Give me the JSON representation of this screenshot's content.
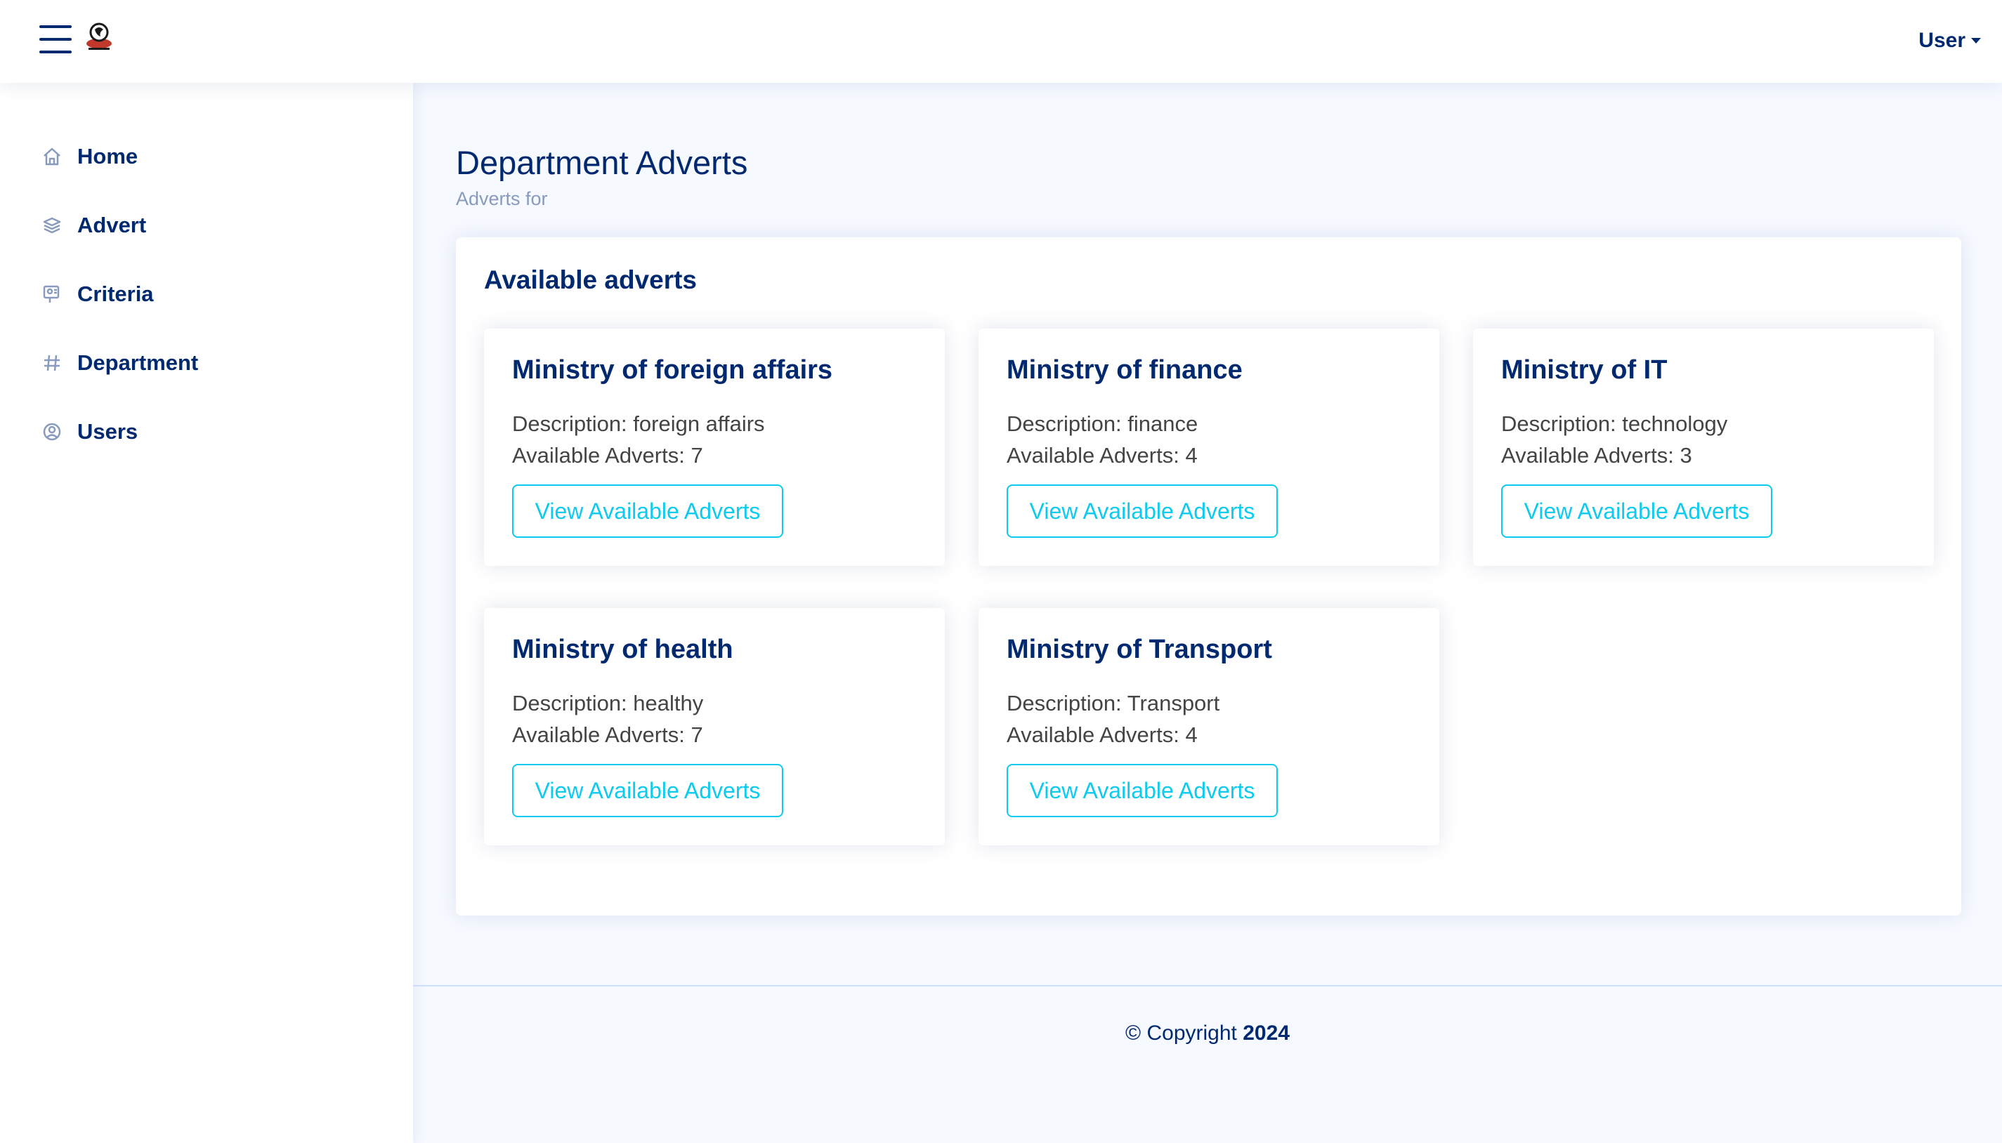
{
  "header": {
    "user_label": "User",
    "icons": {
      "menu": "hamburger-menu-icon",
      "logo": "app-logo",
      "caret": "caret-down-icon"
    }
  },
  "sidebar": {
    "items": [
      {
        "label": "Home",
        "icon": "home-icon"
      },
      {
        "label": "Advert",
        "icon": "layers-icon"
      },
      {
        "label": "Criteria",
        "icon": "person-badge-icon"
      },
      {
        "label": "Department",
        "icon": "hash-icon"
      },
      {
        "label": "Users",
        "icon": "person-circle-icon"
      }
    ]
  },
  "main": {
    "title": "Department Adverts",
    "subtitle": "Adverts for",
    "panel_title": "Available adverts",
    "departments": [
      {
        "name": "Ministry of foreign affairs",
        "description": "Description: foreign affairs",
        "count": "Available Adverts: 7",
        "button": "View Available Adverts"
      },
      {
        "name": "Ministry of finance",
        "description": "Description: finance",
        "count": "Available Adverts: 4",
        "button": "View Available Adverts"
      },
      {
        "name": "Ministry of IT",
        "description": "Description: technology",
        "count": "Available Adverts: 3",
        "button": "View Available Adverts"
      },
      {
        "name": "Ministry of health",
        "description": "Description: healthy",
        "count": "Available Adverts: 7",
        "button": "View Available Adverts"
      },
      {
        "name": "Ministry of Transport",
        "description": "Description: Transport",
        "count": "Available Adverts: 4",
        "button": "View Available Adverts"
      }
    ]
  },
  "footer": {
    "copyright_prefix": "© Copyright ",
    "year": "2024"
  },
  "colors": {
    "primary": "#012970",
    "accent": "#0dcaf0",
    "background": "#f6f9ff",
    "muted": "#899bbd"
  }
}
